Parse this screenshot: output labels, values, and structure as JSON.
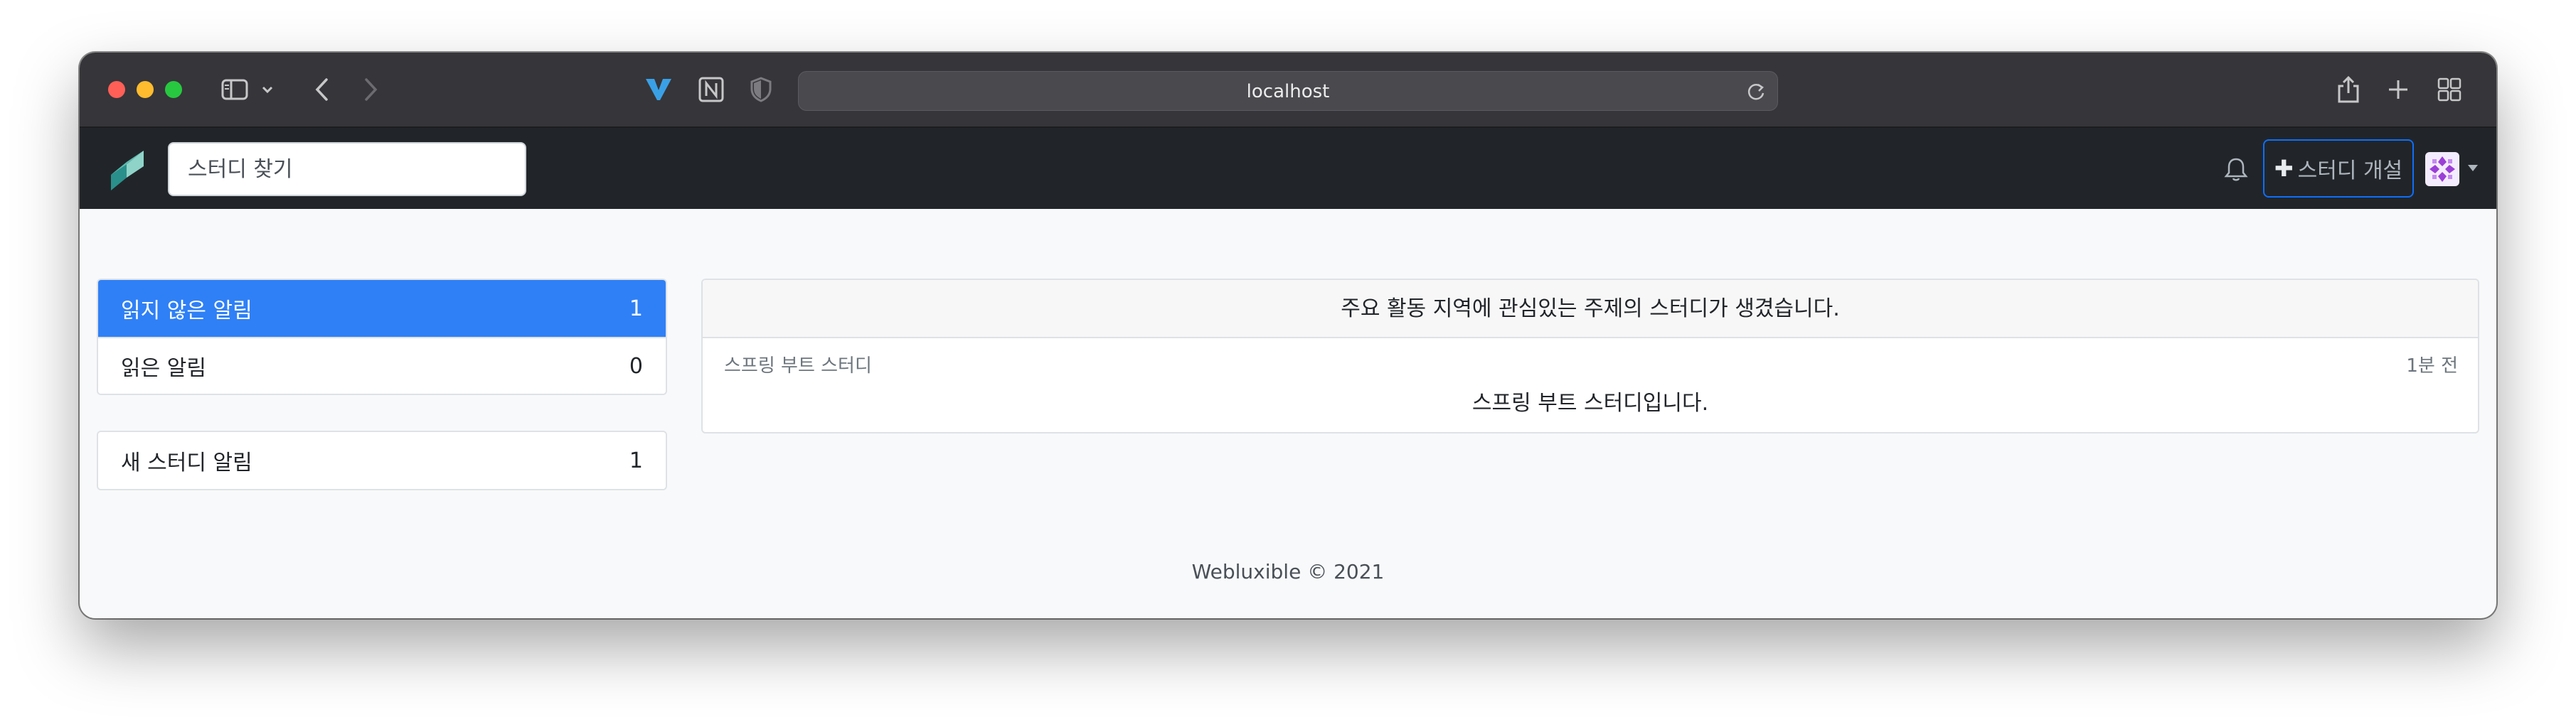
{
  "browser": {
    "url": "localhost",
    "icons": {
      "sidebar": "sidebar-icon",
      "back": "chevron-left-icon",
      "forward": "chevron-right-icon",
      "reload": "reload-icon",
      "share": "share-icon",
      "new_tab": "plus-icon",
      "tab_overview": "grid-icon"
    },
    "extensions": [
      "vimari-icon",
      "notion-icon",
      "shield-icon"
    ]
  },
  "navbar": {
    "search_placeholder": "스터디 찾기",
    "create_study_label": "스터디 개설",
    "bell_icon": "bell-icon",
    "brand_color": "#212529"
  },
  "sidebar": {
    "groups": [
      [
        {
          "label": "읽지 않은 알림",
          "count": "1",
          "active": true
        },
        {
          "label": "읽은 알림",
          "count": "0",
          "active": false
        }
      ],
      [
        {
          "label": "새 스터디 알림",
          "count": "1",
          "active": false
        }
      ]
    ],
    "accent_color": "#2f80f6"
  },
  "notification": {
    "header": "주요 활동 지역에 관심있는 주제의 스터디가 생겼습니다.",
    "study_title": "스프링 부트 스터디",
    "time_ago": "1분 전",
    "description": "스프링 부트 스터디입니다."
  },
  "footer": {
    "text": "Webluxible © 2021"
  }
}
